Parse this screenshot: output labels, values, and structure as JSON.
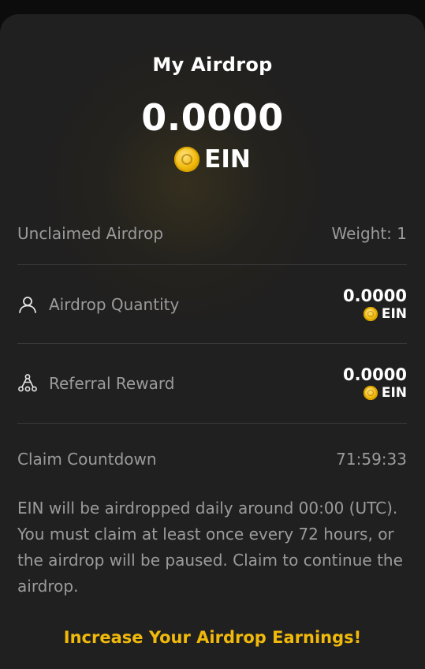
{
  "card": {
    "title": "My Airdrop",
    "total_amount": "0.0000",
    "token_symbol": "EIN",
    "token_icon": "ein-coin-icon"
  },
  "unclaimed": {
    "label": "Unclaimed Airdrop",
    "weight": "Weight: 1"
  },
  "airdrop_quantity": {
    "label": "Airdrop Quantity",
    "icon": "user-icon",
    "value": "0.0000",
    "token": "EIN"
  },
  "referral_reward": {
    "label": "Referral Reward",
    "icon": "network-icon",
    "value": "0.0000",
    "token": "EIN"
  },
  "countdown": {
    "label": "Claim Countdown",
    "value": "71:59:33"
  },
  "info_text": "EIN will be airdropped daily around 00:00 (UTC). You must claim at least once every 72 hours, or the airdrop will be paused. Claim to continue the airdrop.",
  "cta_label": "Increase Your Airdrop Earnings!",
  "colors": {
    "background": "#202020",
    "accent": "#f0b90b",
    "muted_text": "#9b9b9b",
    "primary_text": "#ffffff"
  }
}
